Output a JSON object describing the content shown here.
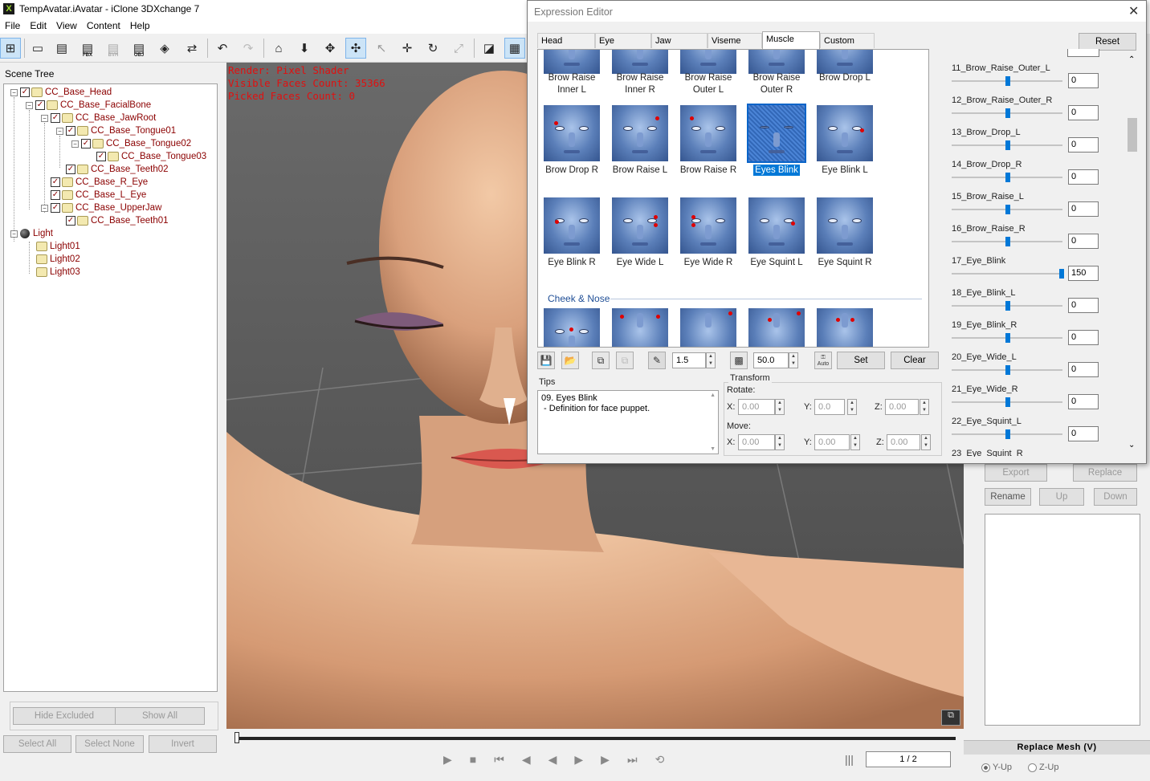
{
  "window": {
    "title": "TempAvatar.iAvatar - iClone 3DXchange 7",
    "app_icon": "X"
  },
  "menu": [
    "File",
    "Edit",
    "View",
    "Content",
    "Help"
  ],
  "toolbar_badges": {
    "fbx": "FBX",
    "bvh": "BVH",
    "obj": "OBJ"
  },
  "scene_tree": {
    "label": "Scene Tree",
    "nodes": [
      "CC_Base_Head",
      "CC_Base_FacialBone",
      "CC_Base_JawRoot",
      "CC_Base_Tongue01",
      "CC_Base_Tongue02",
      "CC_Base_Tongue03",
      "CC_Base_Teeth02",
      "CC_Base_R_Eye",
      "CC_Base_L_Eye",
      "CC_Base_UpperJaw",
      "CC_Base_Teeth01",
      "Light",
      "Light01",
      "Light02",
      "Light03"
    ]
  },
  "left_buttons": {
    "hide_excluded": "Hide Excluded",
    "show_all": "Show All",
    "select_all": "Select All",
    "select_none": "Select None",
    "invert": "Invert"
  },
  "viewport": {
    "render": "Render: Pixel Shader",
    "visible_faces": "Visible Faces Count: 35366",
    "picked_faces": "Picked Faces Count: 0"
  },
  "timeline": {
    "page": "1 / 2"
  },
  "right_panel": {
    "export": "Export",
    "replace": "Replace",
    "rename": "Rename",
    "up": "Up",
    "down": "Down",
    "replace_mesh": "Replace Mesh (V)",
    "y_up": "Y-Up",
    "z_up": "Z-Up"
  },
  "expression_editor": {
    "title": "Expression Editor",
    "tabs": [
      "Head",
      "Eye",
      "Jaw",
      "Viseme",
      "Muscle",
      "Custom"
    ],
    "active_tab": "Muscle",
    "reset": "Reset",
    "faces_row1": [
      "Brow Raise Inner L",
      "Brow Raise Inner R",
      "Brow Raise Outer L",
      "Brow Raise Outer R",
      "Brow Drop L"
    ],
    "faces_row2": [
      "Brow Drop R",
      "Brow Raise L",
      "Brow Raise R",
      "Eyes Blink",
      "Eye Blink L"
    ],
    "faces_row3": [
      "Eye Blink R",
      "Eye Wide L",
      "Eye Wide R",
      "Eye Squint L",
      "Eye Squint R"
    ],
    "selected_face": "Eyes Blink",
    "section_cheek": "Cheek & Nose",
    "strength": "1.5",
    "percent": "50.0",
    "auto": "Auto",
    "set": "Set",
    "clear": "Clear",
    "tips_label": "Tips",
    "tips_line1": "09. Eyes Blink",
    "tips_line2": " - Definition for face puppet.",
    "transform_label": "Transform",
    "rotate_label": "Rotate:",
    "move_label": "Move:",
    "x_label": "X:",
    "y_label": "Y:",
    "z_label": "Z:",
    "rot": {
      "x": "0.00",
      "y": "0.0",
      "z": "0.00"
    },
    "mov": {
      "x": "0.00",
      "y": "0.00",
      "z": "0.00"
    },
    "sliders": [
      {
        "name": "11_Brow_Raise_Outer_L",
        "value": "0",
        "level": 0
      },
      {
        "name": "12_Brow_Raise_Outer_R",
        "value": "0",
        "level": 0
      },
      {
        "name": "13_Brow_Drop_L",
        "value": "0",
        "level": 0
      },
      {
        "name": "14_Brow_Drop_R",
        "value": "0",
        "level": 0
      },
      {
        "name": "15_Brow_Raise_L",
        "value": "0",
        "level": 0
      },
      {
        "name": "16_Brow_Raise_R",
        "value": "0",
        "level": 0
      },
      {
        "name": "17_Eye_Blink",
        "value": "150",
        "level": 150
      },
      {
        "name": "18_Eye_Blink_L",
        "value": "0",
        "level": 0
      },
      {
        "name": "19_Eye_Blink_R",
        "value": "0",
        "level": 0
      },
      {
        "name": "20_Eye_Wide_L",
        "value": "0",
        "level": 0
      },
      {
        "name": "21_Eye_Wide_R",
        "value": "0",
        "level": 0
      },
      {
        "name": "22_Eye_Squint_L",
        "value": "0",
        "level": 0
      },
      {
        "name": "23_Eye_Squint_R",
        "value": "",
        "level": 0
      }
    ]
  },
  "colors": {
    "accent": "#0078d7",
    "overlay_red": "#e01010",
    "tree_text": "#8b0000"
  }
}
